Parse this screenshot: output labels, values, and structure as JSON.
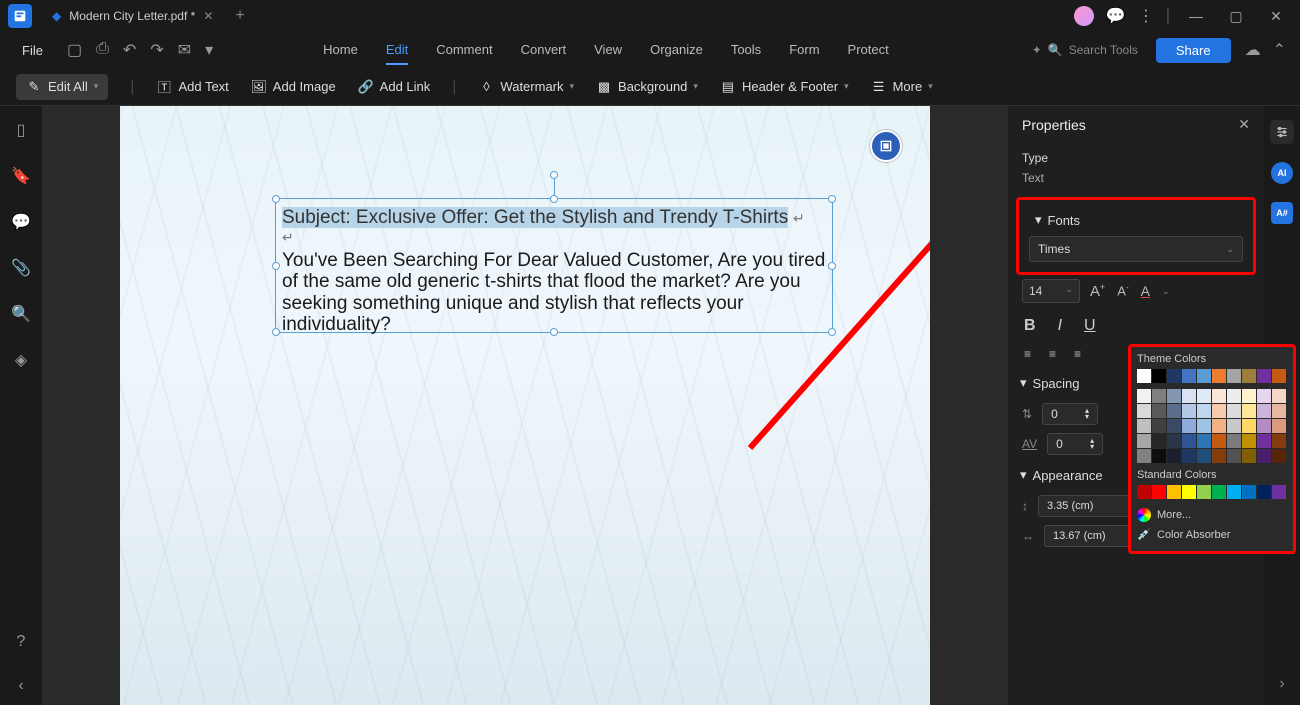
{
  "titlebar": {
    "tab_title": "Modern City Letter.pdf *",
    "close": "✕",
    "plus": "+",
    "min": "—",
    "max": "▢",
    "closewin": "✕"
  },
  "file_menu": "File",
  "main_tabs": [
    "Home",
    "Edit",
    "Comment",
    "Convert",
    "View",
    "Organize",
    "Tools",
    "Form",
    "Protect"
  ],
  "main_tab_active": 1,
  "search_placeholder": "Search Tools",
  "share_label": "Share",
  "toolbar": {
    "edit_all": "Edit All",
    "add_text": "Add Text",
    "add_image": "Add Image",
    "add_link": "Add Link",
    "watermark": "Watermark",
    "background": "Background",
    "header_footer": "Header & Footer",
    "more": "More"
  },
  "document": {
    "subject": "Subject: Exclusive Offer: Get the Stylish and Trendy T-Shirts",
    "body": "You've Been Searching For Dear Valued Customer, Are you tired of the same old generic t-shirts that flood the market? Are you seeking something unique and stylish that reflects your individuality?"
  },
  "props": {
    "title": "Properties",
    "type_label": "Type",
    "type_value": "Text",
    "fonts_label": "Fonts",
    "font_family": "Times",
    "font_size": "14",
    "spacing_label": "Spacing",
    "spacing_line": "0",
    "spacing_letter": "0",
    "appearance_label": "Appearance",
    "width_val": "3.35 (cm)",
    "height_val": "13.67 (cm)"
  },
  "colors": {
    "theme_label": "Theme Colors",
    "standard_label": "Standard Colors",
    "more_label": "More...",
    "absorber_label": "Color Absorber",
    "theme_row1": [
      "#ffffff",
      "#000000",
      "#1f3864",
      "#4472c4",
      "#5b9bd5",
      "#ed7d31",
      "#a5a5a5",
      "#9e7c3a",
      "#7030a0",
      "#c55a11"
    ],
    "theme_shades": [
      [
        "#f2f2f2",
        "#7f7f7f",
        "#8497b0",
        "#d9e2f3",
        "#deebf7",
        "#fbe5d6",
        "#ededed",
        "#fff2cc",
        "#e6d5ec",
        "#f2d6c6"
      ],
      [
        "#d9d9d9",
        "#595959",
        "#5a6e8c",
        "#b4c7e7",
        "#bdd7ee",
        "#f8cbad",
        "#dbdbdb",
        "#ffe699",
        "#ccb3d9",
        "#e6b8a2"
      ],
      [
        "#bfbfbf",
        "#404040",
        "#3b4a63",
        "#8faadc",
        "#9dc3e6",
        "#f4b183",
        "#c9c9c9",
        "#ffd966",
        "#b38cc6",
        "#d99a7e"
      ],
      [
        "#a6a6a6",
        "#262626",
        "#2a3547",
        "#2f5597",
        "#2e75b6",
        "#c55a11",
        "#7b7b7b",
        "#bf9000",
        "#7030a0",
        "#833c0c"
      ],
      [
        "#808080",
        "#0d0d0d",
        "#1a202c",
        "#1f3864",
        "#1f4e79",
        "#843c0c",
        "#525252",
        "#806000",
        "#4a1f6b",
        "#572508"
      ]
    ],
    "standard": [
      "#c00000",
      "#ff0000",
      "#ffc000",
      "#ffff00",
      "#92d050",
      "#00b050",
      "#00b0f0",
      "#0070c0",
      "#002060",
      "#7030a0"
    ]
  }
}
